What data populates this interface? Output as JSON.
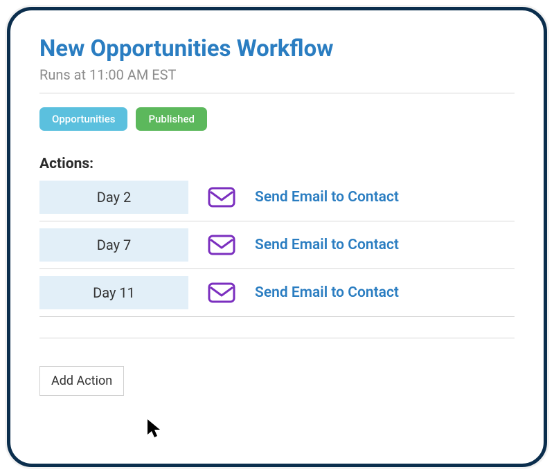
{
  "header": {
    "title": "New Opportunities Workflow",
    "subtitle": "Runs at 11:00 AM EST"
  },
  "badges": {
    "category": "Opportunities",
    "status": "Published"
  },
  "actions": {
    "label": "Actions:",
    "items": [
      {
        "day": "Day 2",
        "icon": "envelope",
        "text": "Send Email to Contact"
      },
      {
        "day": "Day 7",
        "icon": "envelope",
        "text": "Send Email to Contact"
      },
      {
        "day": "Day 11",
        "icon": "envelope",
        "text": "Send Email to Contact"
      }
    ]
  },
  "buttons": {
    "add_action": "Add Action"
  }
}
